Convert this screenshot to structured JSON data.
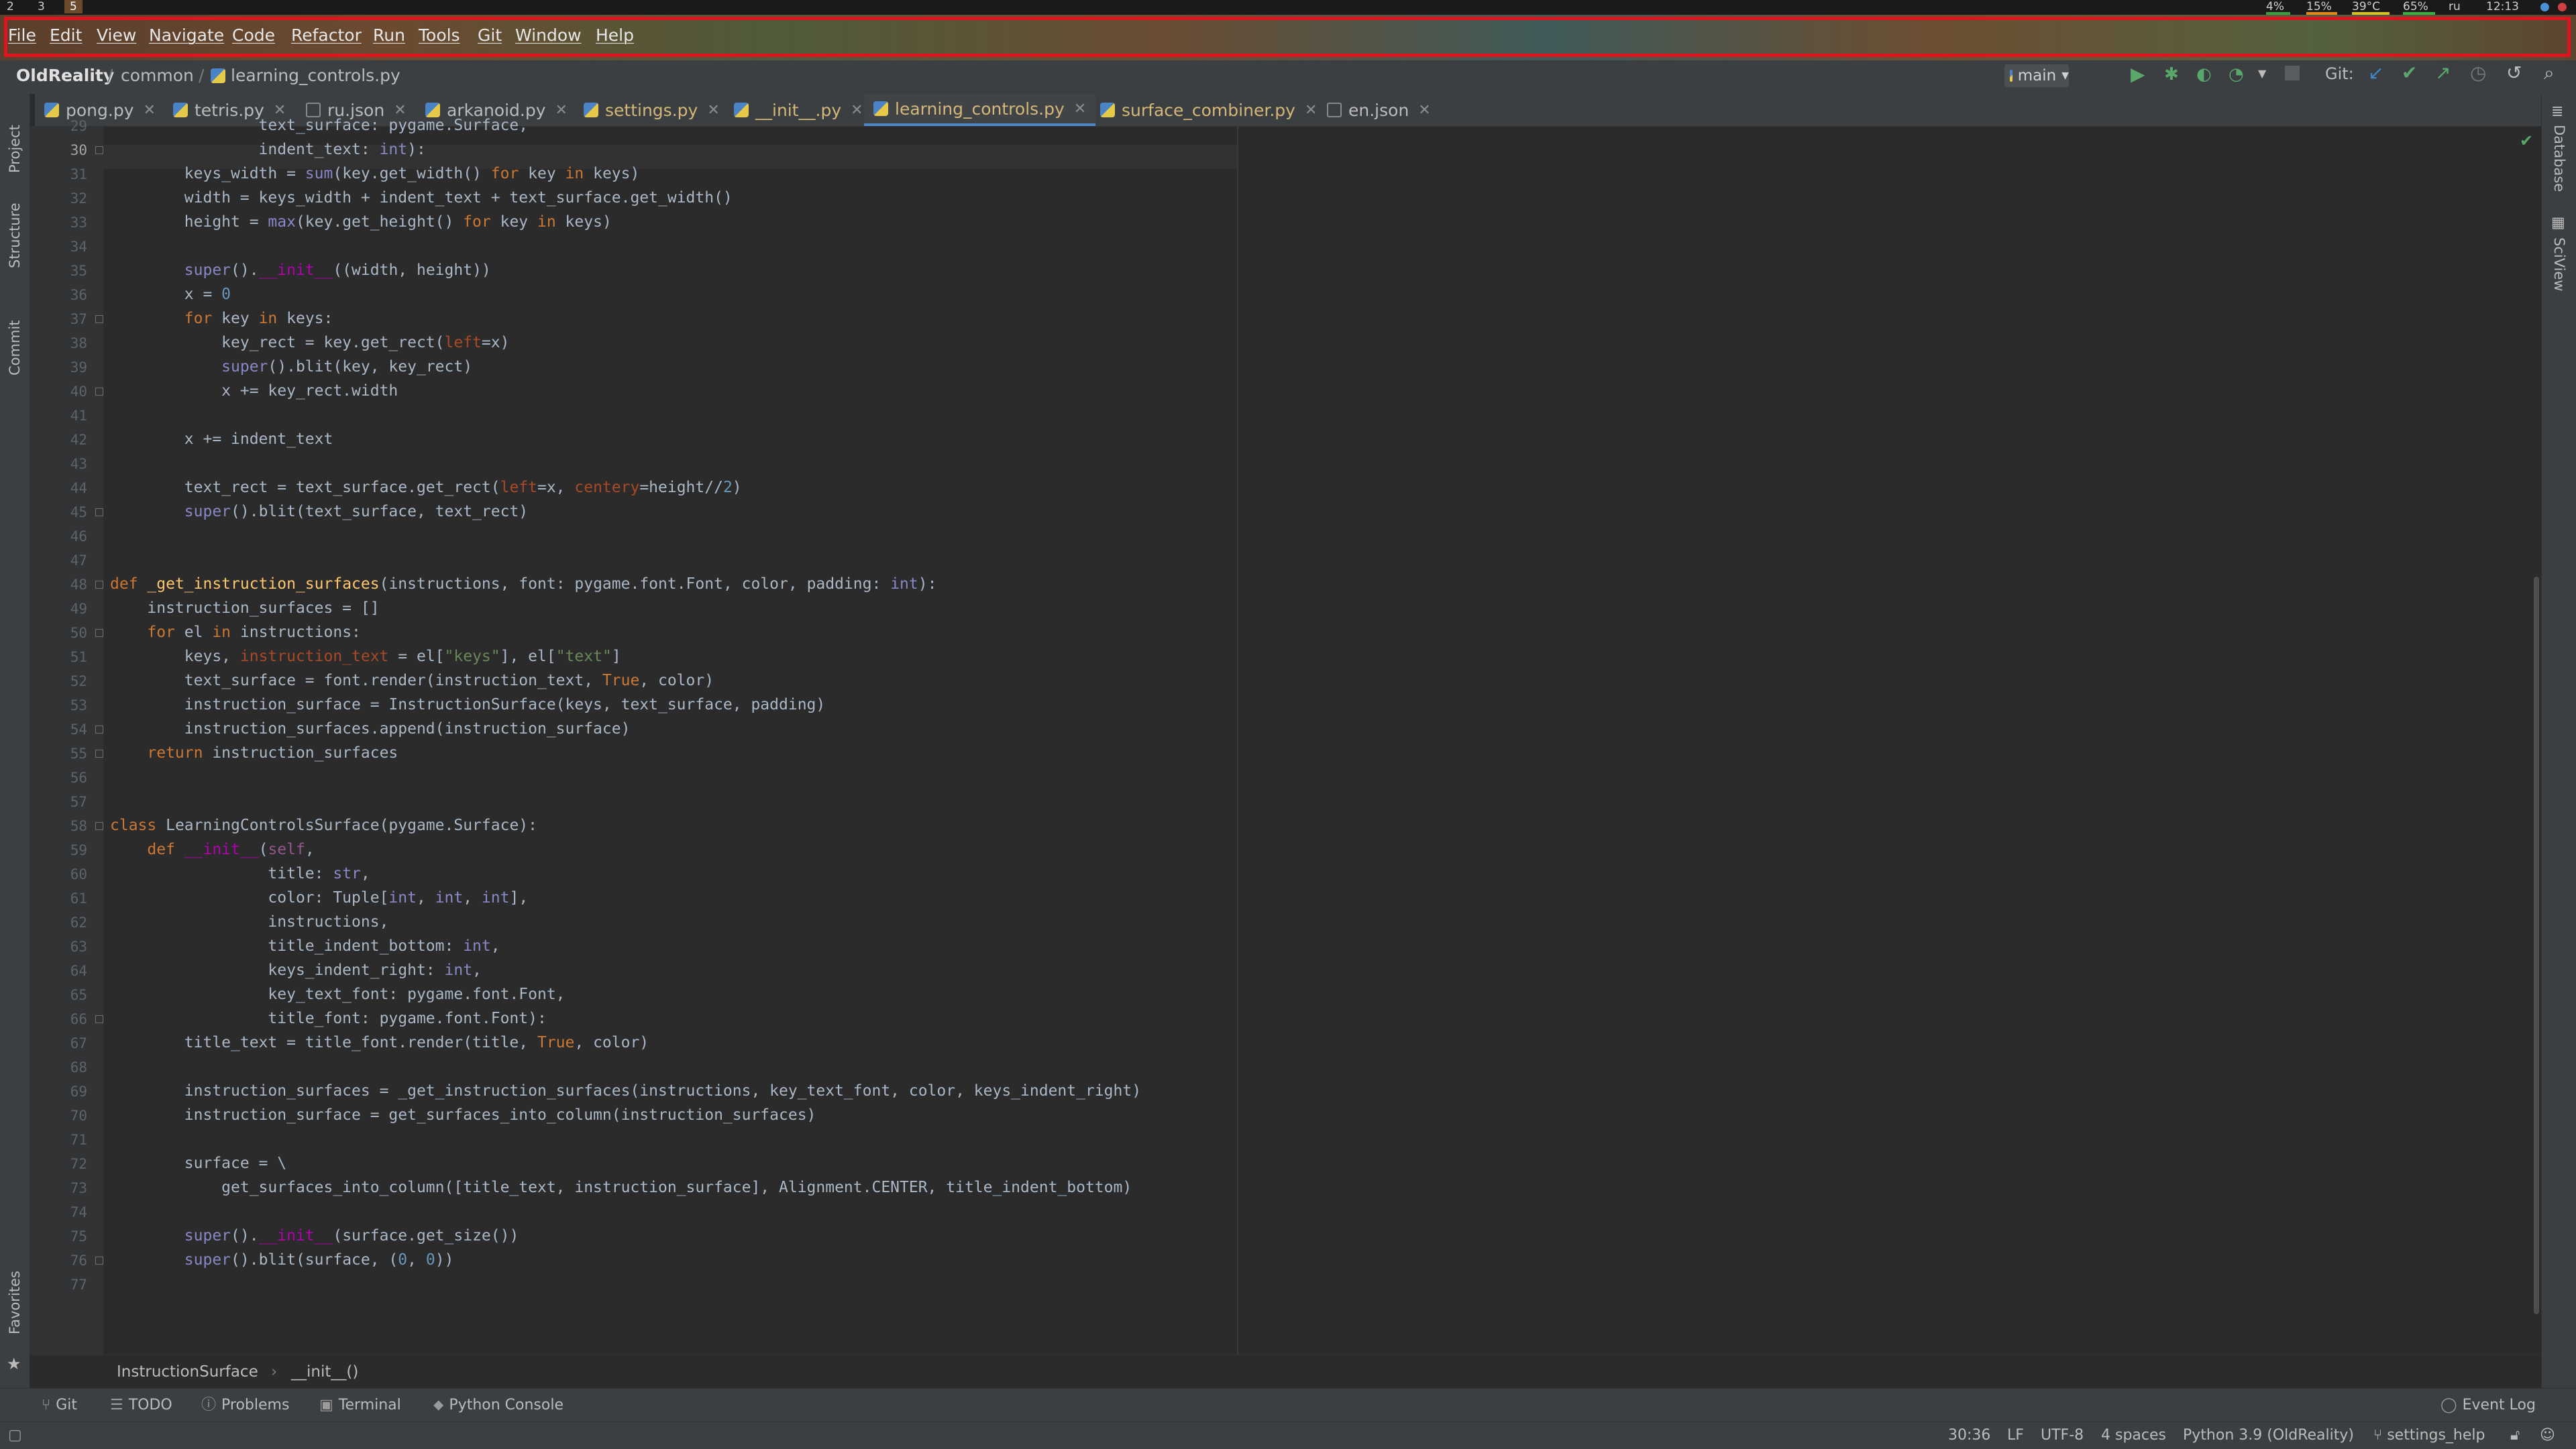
{
  "system": {
    "workspaces": [
      "2",
      "3",
      "5"
    ],
    "cpu": "4%",
    "mem": "15%",
    "temp": "39°C",
    "battery": "65%",
    "layout": "ru",
    "clock": "12:13"
  },
  "menu": [
    "File",
    "Edit",
    "View",
    "Navigate",
    "Code",
    "Refactor",
    "Run",
    "Tools",
    "Git",
    "Window",
    "Help"
  ],
  "nav": {
    "project": "OldReality",
    "folder": "common",
    "file": "learning_controls.py",
    "branch": "main",
    "git_label": "Git:"
  },
  "tabs": [
    {
      "label": "pong.py",
      "kind": "py"
    },
    {
      "label": "tetris.py",
      "kind": "py"
    },
    {
      "label": "ru.json",
      "kind": "json"
    },
    {
      "label": "arkanoid.py",
      "kind": "py"
    },
    {
      "label": "settings.py",
      "kind": "py"
    },
    {
      "label": "__init__.py",
      "kind": "py"
    },
    {
      "label": "learning_controls.py",
      "kind": "py",
      "active": true
    },
    {
      "label": "surface_combiner.py",
      "kind": "py"
    },
    {
      "label": "en.json",
      "kind": "json"
    }
  ],
  "left_strip": [
    "Project",
    "Structure",
    "Commit",
    "Favorites"
  ],
  "right_strip": [
    "Database",
    "SciView"
  ],
  "code_lines": [
    {
      "n": "29",
      "t": "                text_surface: pygame.Surface,"
    },
    {
      "n": "30",
      "t": "                indent_text: int):"
    },
    {
      "n": "31",
      "t": "        keys_width = sum(key.get_width() for key in keys)"
    },
    {
      "n": "32",
      "t": "        width = keys_width + indent_text + text_surface.get_width()"
    },
    {
      "n": "33",
      "t": "        height = max(key.get_height() for key in keys)"
    },
    {
      "n": "34",
      "t": ""
    },
    {
      "n": "35",
      "t": "        super().__init__((width, height))"
    },
    {
      "n": "36",
      "t": "        x = 0"
    },
    {
      "n": "37",
      "t": "        for key in keys:"
    },
    {
      "n": "38",
      "t": "            key_rect = key.get_rect(left=x)"
    },
    {
      "n": "39",
      "t": "            super().blit(key, key_rect)"
    },
    {
      "n": "40",
      "t": "            x += key_rect.width"
    },
    {
      "n": "41",
      "t": ""
    },
    {
      "n": "42",
      "t": "        x += indent_text"
    },
    {
      "n": "43",
      "t": ""
    },
    {
      "n": "44",
      "t": "        text_rect = text_surface.get_rect(left=x, centery=height//2)"
    },
    {
      "n": "45",
      "t": "        super().blit(text_surface, text_rect)"
    },
    {
      "n": "46",
      "t": ""
    },
    {
      "n": "47",
      "t": ""
    },
    {
      "n": "48",
      "t": "def _get_instruction_surfaces(instructions, font: pygame.font.Font, color, padding: int):"
    },
    {
      "n": "49",
      "t": "    instruction_surfaces = []"
    },
    {
      "n": "50",
      "t": "    for el in instructions:"
    },
    {
      "n": "51",
      "t": "        keys, instruction_text = el[\"keys\"], el[\"text\"]"
    },
    {
      "n": "52",
      "t": "        text_surface = font.render(instruction_text, True, color)"
    },
    {
      "n": "53",
      "t": "        instruction_surface = InstructionSurface(keys, text_surface, padding)"
    },
    {
      "n": "54",
      "t": "        instruction_surfaces.append(instruction_surface)"
    },
    {
      "n": "55",
      "t": "    return instruction_surfaces"
    },
    {
      "n": "56",
      "t": ""
    },
    {
      "n": "57",
      "t": ""
    },
    {
      "n": "58",
      "t": "class LearningControlsSurface(pygame.Surface):"
    },
    {
      "n": "59",
      "t": "    def __init__(self,"
    },
    {
      "n": "60",
      "t": "                 title: str,"
    },
    {
      "n": "61",
      "t": "                 color: Tuple[int, int, int],"
    },
    {
      "n": "62",
      "t": "                 instructions,"
    },
    {
      "n": "63",
      "t": "                 title_indent_bottom: int,"
    },
    {
      "n": "64",
      "t": "                 keys_indent_right: int,"
    },
    {
      "n": "65",
      "t": "                 key_text_font: pygame.font.Font,"
    },
    {
      "n": "66",
      "t": "                 title_font: pygame.font.Font):"
    },
    {
      "n": "67",
      "t": "        title_text = title_font.render(title, True, color)"
    },
    {
      "n": "68",
      "t": ""
    },
    {
      "n": "69",
      "t": "        instruction_surfaces = _get_instruction_surfaces(instructions, key_text_font, color, keys_indent_right)"
    },
    {
      "n": "70",
      "t": "        instruction_surface = get_surfaces_into_column(instruction_surfaces)"
    },
    {
      "n": "71",
      "t": ""
    },
    {
      "n": "72",
      "t": "        surface = \\"
    },
    {
      "n": "73",
      "t": "            get_surfaces_into_column([title_text, instruction_surface], Alignment.CENTER, title_indent_bottom)"
    },
    {
      "n": "74",
      "t": ""
    },
    {
      "n": "75",
      "t": "        super().__init__(surface.get_size())"
    },
    {
      "n": "76",
      "t": "        super().blit(surface, (0, 0))"
    },
    {
      "n": "77",
      "t": ""
    }
  ],
  "code_breadcrumb": [
    "InstructionSurface",
    "__init__()"
  ],
  "tool_windows": [
    {
      "label": "Git",
      "icon": "git-branch-icon"
    },
    {
      "label": "TODO",
      "icon": "list-icon"
    },
    {
      "label": "Problems",
      "icon": "info-icon"
    },
    {
      "label": "Terminal",
      "icon": "terminal-icon"
    },
    {
      "label": "Python Console",
      "icon": "python-icon"
    }
  ],
  "event_log": "Event Log",
  "status": {
    "position": "30:36",
    "line_sep": "LF",
    "encoding": "UTF-8",
    "indent": "4 spaces",
    "interpreter": "Python 3.9 (OldReality)",
    "vcs_branch": "settings_help"
  }
}
